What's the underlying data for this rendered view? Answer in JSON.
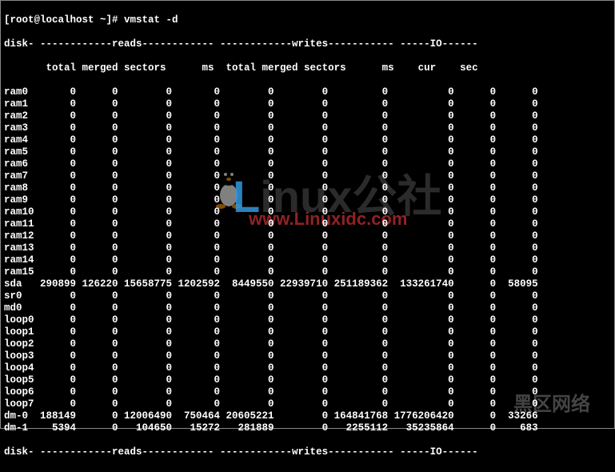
{
  "prompt": "[root@localhost ~]# ",
  "command": "vmstat -d",
  "header1": "disk- ------------reads------------ ------------writes----------- -----IO------",
  "header2": "       total merged sectors      ms  total merged sectors      ms    cur    sec",
  "footer": "disk- ------------reads------------ ------------writes----------- -----IO------",
  "watermark_text_l": "L",
  "watermark_text_rest": "inux公社",
  "watermark_url": "www.Linuxidc.com",
  "watermark2": "黑区网络",
  "rows": [
    {
      "disk": "ram0",
      "r_total": "0",
      "r_merged": "0",
      "r_sectors": "0",
      "r_ms": "0",
      "w_total": "0",
      "w_merged": "0",
      "w_sectors": "0",
      "w_ms": "0",
      "cur": "0",
      "sec": "0"
    },
    {
      "disk": "ram1",
      "r_total": "0",
      "r_merged": "0",
      "r_sectors": "0",
      "r_ms": "0",
      "w_total": "0",
      "w_merged": "0",
      "w_sectors": "0",
      "w_ms": "0",
      "cur": "0",
      "sec": "0"
    },
    {
      "disk": "ram2",
      "r_total": "0",
      "r_merged": "0",
      "r_sectors": "0",
      "r_ms": "0",
      "w_total": "0",
      "w_merged": "0",
      "w_sectors": "0",
      "w_ms": "0",
      "cur": "0",
      "sec": "0"
    },
    {
      "disk": "ram3",
      "r_total": "0",
      "r_merged": "0",
      "r_sectors": "0",
      "r_ms": "0",
      "w_total": "0",
      "w_merged": "0",
      "w_sectors": "0",
      "w_ms": "0",
      "cur": "0",
      "sec": "0"
    },
    {
      "disk": "ram4",
      "r_total": "0",
      "r_merged": "0",
      "r_sectors": "0",
      "r_ms": "0",
      "w_total": "0",
      "w_merged": "0",
      "w_sectors": "0",
      "w_ms": "0",
      "cur": "0",
      "sec": "0"
    },
    {
      "disk": "ram5",
      "r_total": "0",
      "r_merged": "0",
      "r_sectors": "0",
      "r_ms": "0",
      "w_total": "0",
      "w_merged": "0",
      "w_sectors": "0",
      "w_ms": "0",
      "cur": "0",
      "sec": "0"
    },
    {
      "disk": "ram6",
      "r_total": "0",
      "r_merged": "0",
      "r_sectors": "0",
      "r_ms": "0",
      "w_total": "0",
      "w_merged": "0",
      "w_sectors": "0",
      "w_ms": "0",
      "cur": "0",
      "sec": "0"
    },
    {
      "disk": "ram7",
      "r_total": "0",
      "r_merged": "0",
      "r_sectors": "0",
      "r_ms": "0",
      "w_total": "0",
      "w_merged": "0",
      "w_sectors": "0",
      "w_ms": "0",
      "cur": "0",
      "sec": "0"
    },
    {
      "disk": "ram8",
      "r_total": "0",
      "r_merged": "0",
      "r_sectors": "0",
      "r_ms": "0",
      "w_total": "0",
      "w_merged": "0",
      "w_sectors": "0",
      "w_ms": "0",
      "cur": "0",
      "sec": "0"
    },
    {
      "disk": "ram9",
      "r_total": "0",
      "r_merged": "0",
      "r_sectors": "0",
      "r_ms": "0",
      "w_total": "0",
      "w_merged": "0",
      "w_sectors": "0",
      "w_ms": "0",
      "cur": "0",
      "sec": "0"
    },
    {
      "disk": "ram10",
      "r_total": "0",
      "r_merged": "0",
      "r_sectors": "0",
      "r_ms": "0",
      "w_total": "0",
      "w_merged": "0",
      "w_sectors": "0",
      "w_ms": "0",
      "cur": "0",
      "sec": "0"
    },
    {
      "disk": "ram11",
      "r_total": "0",
      "r_merged": "0",
      "r_sectors": "0",
      "r_ms": "0",
      "w_total": "0",
      "w_merged": "0",
      "w_sectors": "0",
      "w_ms": "0",
      "cur": "0",
      "sec": "0"
    },
    {
      "disk": "ram12",
      "r_total": "0",
      "r_merged": "0",
      "r_sectors": "0",
      "r_ms": "0",
      "w_total": "0",
      "w_merged": "0",
      "w_sectors": "0",
      "w_ms": "0",
      "cur": "0",
      "sec": "0"
    },
    {
      "disk": "ram13",
      "r_total": "0",
      "r_merged": "0",
      "r_sectors": "0",
      "r_ms": "0",
      "w_total": "0",
      "w_merged": "0",
      "w_sectors": "0",
      "w_ms": "0",
      "cur": "0",
      "sec": "0"
    },
    {
      "disk": "ram14",
      "r_total": "0",
      "r_merged": "0",
      "r_sectors": "0",
      "r_ms": "0",
      "w_total": "0",
      "w_merged": "0",
      "w_sectors": "0",
      "w_ms": "0",
      "cur": "0",
      "sec": "0"
    },
    {
      "disk": "ram15",
      "r_total": "0",
      "r_merged": "0",
      "r_sectors": "0",
      "r_ms": "0",
      "w_total": "0",
      "w_merged": "0",
      "w_sectors": "0",
      "w_ms": "0",
      "cur": "0",
      "sec": "0"
    },
    {
      "disk": "sda",
      "r_total": "290899",
      "r_merged": "126220",
      "r_sectors": "15658775",
      "r_ms": "1202592",
      "w_total": "8449550",
      "w_merged": "22939710",
      "w_sectors": "251189362",
      "w_ms": "133261740",
      "cur": "0",
      "sec": "58095"
    },
    {
      "disk": "sr0",
      "r_total": "0",
      "r_merged": "0",
      "r_sectors": "0",
      "r_ms": "0",
      "w_total": "0",
      "w_merged": "0",
      "w_sectors": "0",
      "w_ms": "0",
      "cur": "0",
      "sec": "0"
    },
    {
      "disk": "md0",
      "r_total": "0",
      "r_merged": "0",
      "r_sectors": "0",
      "r_ms": "0",
      "w_total": "0",
      "w_merged": "0",
      "w_sectors": "0",
      "w_ms": "0",
      "cur": "0",
      "sec": "0"
    },
    {
      "disk": "loop0",
      "r_total": "0",
      "r_merged": "0",
      "r_sectors": "0",
      "r_ms": "0",
      "w_total": "0",
      "w_merged": "0",
      "w_sectors": "0",
      "w_ms": "0",
      "cur": "0",
      "sec": "0"
    },
    {
      "disk": "loop1",
      "r_total": "0",
      "r_merged": "0",
      "r_sectors": "0",
      "r_ms": "0",
      "w_total": "0",
      "w_merged": "0",
      "w_sectors": "0",
      "w_ms": "0",
      "cur": "0",
      "sec": "0"
    },
    {
      "disk": "loop2",
      "r_total": "0",
      "r_merged": "0",
      "r_sectors": "0",
      "r_ms": "0",
      "w_total": "0",
      "w_merged": "0",
      "w_sectors": "0",
      "w_ms": "0",
      "cur": "0",
      "sec": "0"
    },
    {
      "disk": "loop3",
      "r_total": "0",
      "r_merged": "0",
      "r_sectors": "0",
      "r_ms": "0",
      "w_total": "0",
      "w_merged": "0",
      "w_sectors": "0",
      "w_ms": "0",
      "cur": "0",
      "sec": "0"
    },
    {
      "disk": "loop4",
      "r_total": "0",
      "r_merged": "0",
      "r_sectors": "0",
      "r_ms": "0",
      "w_total": "0",
      "w_merged": "0",
      "w_sectors": "0",
      "w_ms": "0",
      "cur": "0",
      "sec": "0"
    },
    {
      "disk": "loop5",
      "r_total": "0",
      "r_merged": "0",
      "r_sectors": "0",
      "r_ms": "0",
      "w_total": "0",
      "w_merged": "0",
      "w_sectors": "0",
      "w_ms": "0",
      "cur": "0",
      "sec": "0"
    },
    {
      "disk": "loop6",
      "r_total": "0",
      "r_merged": "0",
      "r_sectors": "0",
      "r_ms": "0",
      "w_total": "0",
      "w_merged": "0",
      "w_sectors": "0",
      "w_ms": "0",
      "cur": "0",
      "sec": "0"
    },
    {
      "disk": "loop7",
      "r_total": "0",
      "r_merged": "0",
      "r_sectors": "0",
      "r_ms": "0",
      "w_total": "0",
      "w_merged": "0",
      "w_sectors": "0",
      "w_ms": "0",
      "cur": "0",
      "sec": "0"
    },
    {
      "disk": "dm-0",
      "r_total": "188149",
      "r_merged": "0",
      "r_sectors": "12006490",
      "r_ms": "750464",
      "w_total": "20605221",
      "w_merged": "0",
      "w_sectors": "164841768",
      "w_ms": "1776206420",
      "cur": "0",
      "sec": "33266"
    },
    {
      "disk": "dm-1",
      "r_total": "5394",
      "r_merged": "0",
      "r_sectors": "104650",
      "r_ms": "15272",
      "w_total": "281889",
      "w_merged": "0",
      "w_sectors": "2255112",
      "w_ms": "35235864",
      "cur": "0",
      "sec": "683"
    }
  ]
}
